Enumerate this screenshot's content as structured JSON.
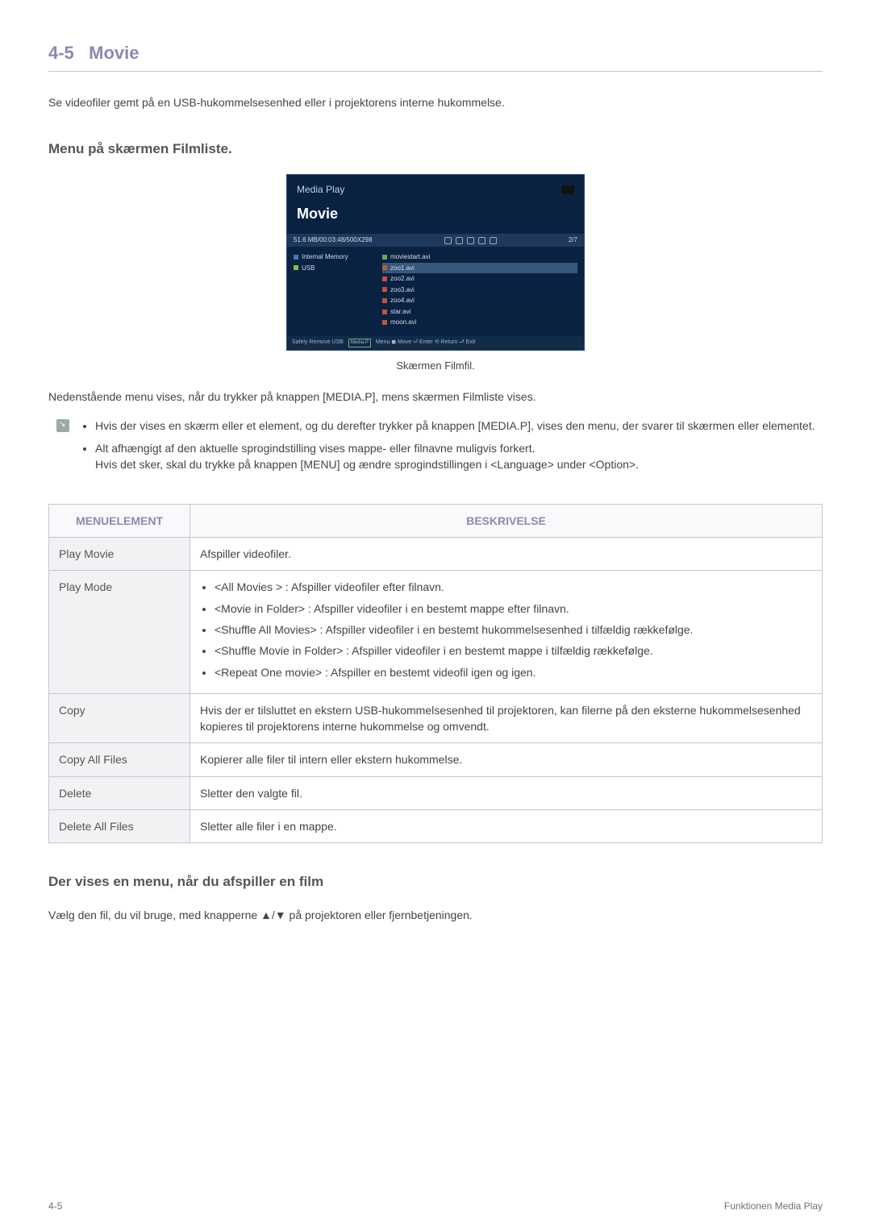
{
  "section": {
    "number": "4-5",
    "title": "Movie"
  },
  "intro": "Se videofiler gemt på en USB-hukommelsesenhed eller i projektorens interne hukommelse.",
  "h2_menu": "Menu på skærmen Filmliste.",
  "screenshot": {
    "media_play": "Media Play",
    "movie": "Movie",
    "status_size": "51.6 MB/00:03:48/500X298",
    "status_count": "2/7",
    "sources": {
      "internal": "Internal Memory",
      "usb": "USB"
    },
    "files": [
      "moviestart.avi",
      "zoo1.avi",
      "zoo2.avi",
      "zoo3.avi",
      "zoo4.avi",
      "star.avi",
      "moon.avi"
    ],
    "footer": {
      "safely": "Safely Remove USB",
      "chip": "Media.P",
      "items": "Menu   ◼ Move  ⏎ Enter  ⟲ Return  ⮐ Exit"
    }
  },
  "caption": "Skærmen Filmfil.",
  "below_caption": "Nedenstående menu vises, når du trykker på knappen [MEDIA.P], mens skærmen Filmliste vises.",
  "notes": {
    "n1": "Hvis der vises en skærm eller et element, og du derefter trykker på knappen [MEDIA.P], vises den menu, der svarer til skærmen eller elementet.",
    "n2a": "Alt afhængigt af den aktuelle sprogindstilling vises mappe- eller filnavne muligvis forkert.",
    "n2b": "Hvis det sker, skal du trykke på knappen [MENU] og ændre sprogindstillingen i <Language> under <Option>."
  },
  "table": {
    "head_menu": "MENUELEMENT",
    "head_desc": "BESKRIVELSE",
    "rows": {
      "play_movie": {
        "k": "Play Movie",
        "v": "Afspiller videofiler."
      },
      "play_mode": {
        "k": "Play Mode",
        "items": [
          "<All Movies > : Afspiller videofiler efter filnavn.",
          "<Movie in Folder> : Afspiller videofiler i en bestemt mappe efter filnavn.",
          "<Shuffle All Movies> : Afspiller videofiler i en bestemt hukommelsesenhed i tilfældig rækkefølge.",
          "<Shuffle Movie in Folder> : Afspiller videofiler i en bestemt mappe i tilfældig rækkefølge.",
          "<Repeat One movie> : Afspiller en bestemt videofil igen og igen."
        ]
      },
      "copy": {
        "k": "Copy",
        "v": "Hvis der er tilsluttet en ekstern USB-hukommelsesenhed til projektoren, kan filerne på den eksterne hukommelsesenhed kopieres til projektorens interne hukommelse og omvendt."
      },
      "copy_all": {
        "k": "Copy All Files",
        "v": "Kopierer alle filer til intern eller ekstern hukommelse."
      },
      "delete": {
        "k": "Delete",
        "v": "Sletter den valgte fil."
      },
      "delete_all": {
        "k": "Delete All Files",
        "v": "Sletter alle filer i en mappe."
      }
    }
  },
  "h2_play": "Der vises en menu, når du afspiller en film",
  "play_text": "Vælg den fil, du vil bruge, med knapperne ▲/▼ på projektoren eller fjernbetjeningen.",
  "footer_left": "4-5",
  "footer_right": "Funktionen Media Play"
}
